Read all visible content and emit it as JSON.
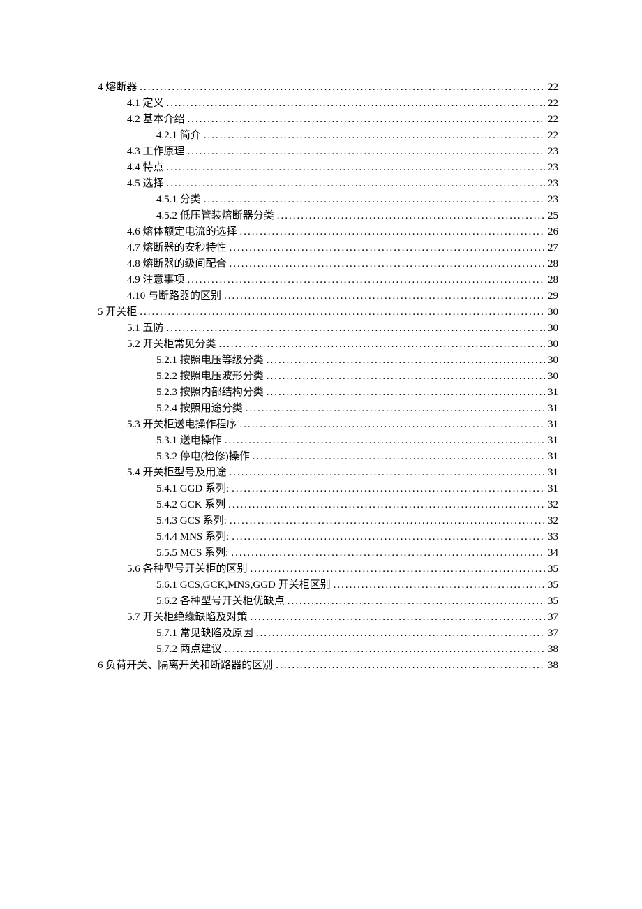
{
  "toc": [
    {
      "indent": 0,
      "label": "4 熔断器",
      "page": "22"
    },
    {
      "indent": 1,
      "label": "4.1 定义",
      "page": "22"
    },
    {
      "indent": 1,
      "label": "4.2 基本介绍",
      "page": "22"
    },
    {
      "indent": 2,
      "label": "4.2.1 简介",
      "page": "22"
    },
    {
      "indent": 1,
      "label": "4.3 工作原理",
      "page": "23"
    },
    {
      "indent": 1,
      "label": "4.4 特点",
      "page": "23"
    },
    {
      "indent": 1,
      "label": "4.5 选择",
      "page": "23"
    },
    {
      "indent": 2,
      "label": "4.5.1 分类",
      "page": "23"
    },
    {
      "indent": 2,
      "label": "4.5.2 低压管装熔断器分类",
      "page": "25"
    },
    {
      "indent": 1,
      "label": "4.6 熔体额定电流的选择",
      "page": "26"
    },
    {
      "indent": 1,
      "label": "4.7 熔断器的安秒特性",
      "page": "27"
    },
    {
      "indent": 1,
      "label": "4.8 熔断器的级间配合",
      "page": "28"
    },
    {
      "indent": 1,
      "label": "4.9 注意事项",
      "page": "28"
    },
    {
      "indent": 1,
      "label": "4.10 与断路器的区别",
      "page": "29"
    },
    {
      "indent": 0,
      "label": "5 开关柜",
      "page": "30"
    },
    {
      "indent": 1,
      "label": "5.1 五防",
      "page": "30"
    },
    {
      "indent": 1,
      "label": "5.2 开关柜常见分类",
      "page": "30"
    },
    {
      "indent": 2,
      "label": "5.2.1 按照电压等级分类",
      "page": "30"
    },
    {
      "indent": 2,
      "label": "5.2.2 按照电压波形分类",
      "page": "30"
    },
    {
      "indent": 2,
      "label": "5.2.3 按照内部结构分类",
      "page": "31"
    },
    {
      "indent": 2,
      "label": "5.2.4 按照用途分类",
      "page": "31"
    },
    {
      "indent": 1,
      "label": "5.3 开关柜送电操作程序",
      "page": "31"
    },
    {
      "indent": 2,
      "label": "5.3.1 送电操作",
      "page": "31"
    },
    {
      "indent": 2,
      "label": "5.3.2 停电(检修)操作",
      "page": "31"
    },
    {
      "indent": 1,
      "label": "5.4   开关柜型号及用途",
      "page": "31"
    },
    {
      "indent": 2,
      "label": "5.4.1   GGD 系列:",
      "page": "31"
    },
    {
      "indent": 2,
      "label": "5.4.2   GCK 系列",
      "page": "32"
    },
    {
      "indent": 2,
      "label": "5.4.3   GCS 系列:",
      "page": "32"
    },
    {
      "indent": 2,
      "label": "5.4.4   MNS 系列:",
      "page": "33"
    },
    {
      "indent": 2,
      "label": "5.5.5   MCS 系列:",
      "page": "34"
    },
    {
      "indent": 1,
      "label": "5.6   各种型号开关柜的区别",
      "page": "35"
    },
    {
      "indent": 2,
      "label": "5.6.1   GCS,GCK,MNS,GGD 开关柜区别",
      "page": "35"
    },
    {
      "indent": 2,
      "label": "5.6.2   各种型号开关柜优缺点",
      "page": "35"
    },
    {
      "indent": 1,
      "label": "5.7 开关柜绝缘缺陷及对策",
      "page": "37"
    },
    {
      "indent": 2,
      "label": "5.7.1 常见缺陷及原因",
      "page": "37"
    },
    {
      "indent": 2,
      "label": "5.7.2 两点建议",
      "page": "38"
    },
    {
      "indent": 0,
      "label": "6 负荷开关、隔离开关和断路器的区别",
      "page": "38"
    }
  ]
}
